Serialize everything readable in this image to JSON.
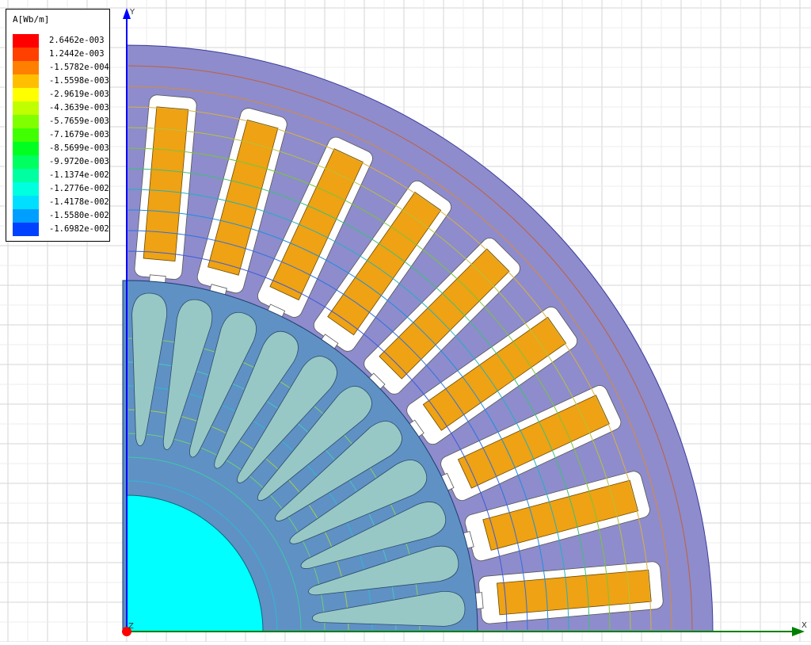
{
  "legend": {
    "title": "A[Wb/m]",
    "items": [
      {
        "value": "2.6462e-003",
        "color": "#ff0000"
      },
      {
        "value": "1.2442e-003",
        "color": "#ff4000"
      },
      {
        "value": "-1.5782e-004",
        "color": "#ff8000"
      },
      {
        "value": "-1.5598e-003",
        "color": "#ffbf00"
      },
      {
        "value": "-2.9619e-003",
        "color": "#ffff00"
      },
      {
        "value": "-4.3639e-003",
        "color": "#bfff00"
      },
      {
        "value": "-5.7659e-003",
        "color": "#80ff00"
      },
      {
        "value": "-7.1679e-003",
        "color": "#40ff00"
      },
      {
        "value": "-8.5699e-003",
        "color": "#00ff20"
      },
      {
        "value": "-9.9720e-003",
        "color": "#00ff60"
      },
      {
        "value": "-1.1374e-002",
        "color": "#00ffa0"
      },
      {
        "value": "-1.2776e-002",
        "color": "#00ffdf"
      },
      {
        "value": "-1.4178e-002",
        "color": "#00dfff"
      },
      {
        "value": "-1.5580e-002",
        "color": "#009fff"
      },
      {
        "value": "-1.6982e-002",
        "color": "#0040ff"
      }
    ]
  },
  "axes": {
    "x_label": "X",
    "y_label": "Y",
    "z_label": "Z"
  },
  "colors": {
    "stator": "#8e8ccc",
    "rotor": "#5f91c4",
    "rotor_bar": "#97c8c6",
    "shaft": "#00ffff",
    "slot": "#ffffff",
    "coil": "#eea214",
    "grid": "#d6d6d6",
    "axis_y": "#0000ff",
    "axis_x": "#008000",
    "origin": "#ff0000"
  }
}
